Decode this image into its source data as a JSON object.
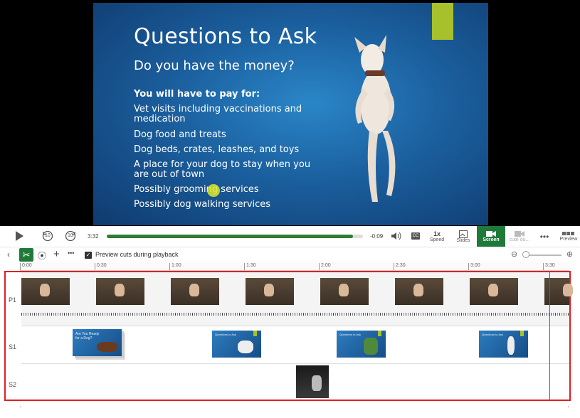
{
  "slide": {
    "title": "Questions to Ask",
    "subtitle": "Do you have the money?",
    "bold_line": "You will have to pay for:",
    "bullets": [
      "Vet visits including vaccinations and medication",
      "Dog food and treats",
      "Dog beds, crates, leashes, and toys",
      "A place for your dog to stay when you are out of town",
      "Possibly grooming services",
      "Possibly dog walking services"
    ]
  },
  "player": {
    "elapsed": "3:32",
    "remaining": "-0:09",
    "progress_fraction": 0.96,
    "rewind_label": "10",
    "forward_label": "10",
    "speed_value": "1x",
    "speed_label": "Speed",
    "slides_label": "Slides",
    "screen_label": "Screen",
    "cute_label": "cute ou...",
    "preview_label": "Preview"
  },
  "edit_toolbar": {
    "preview_cuts_label": "Preview cuts during playback",
    "preview_cuts_checked": true
  },
  "ruler": {
    "ticks": [
      "0:00",
      "0:30",
      "1:00",
      "1:30",
      "2:00",
      "2:30",
      "3:00",
      "3:30"
    ]
  },
  "tracks": [
    {
      "label": "P1"
    },
    {
      "label": "S1"
    },
    {
      "label": "S2"
    }
  ],
  "s1_clips": [
    {
      "title": "Are You Ready for a Dog?"
    },
    {
      "title": "Questions to Ask"
    },
    {
      "title": "Questions to Ask"
    },
    {
      "title": "Questions to Ask"
    }
  ],
  "colors": {
    "accent_green": "#1f7a3a",
    "selection_red": "#e02020",
    "slide_lime": "#a6c12c"
  }
}
